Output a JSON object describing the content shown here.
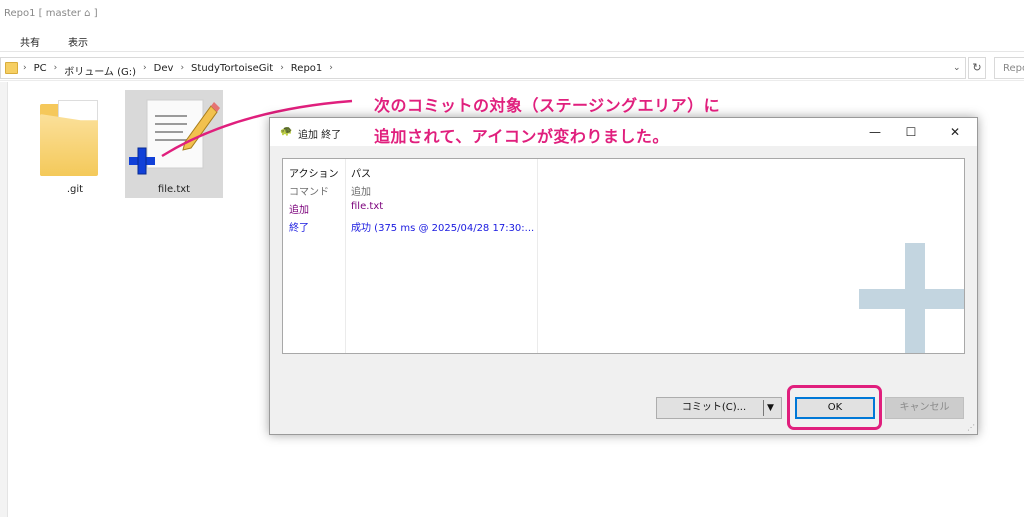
{
  "window": {
    "title": "Repo1 [ master ⌂ ]"
  },
  "ribbon": {
    "tabs": [
      "共有",
      "表示"
    ]
  },
  "address": {
    "crumbs": [
      "PC",
      "ボリューム (G:)",
      "Dev",
      "StudyTortoiseGit",
      "Repo1"
    ],
    "search_placeholder": "Repo"
  },
  "files": [
    {
      "name": ".git"
    },
    {
      "name": "file.txt"
    }
  ],
  "annotation": {
    "line1": "次のコミットの対象（ステージングエリア）に",
    "line2": "追加されて、アイコンが変わりました。",
    "color": "#e01f7d"
  },
  "dialog": {
    "title": "追加 終了",
    "columns": [
      "アクション",
      "パス"
    ],
    "rows": [
      {
        "action": "コマンド",
        "path": "追加",
        "color": "#6d6d6d"
      },
      {
        "action": "追加",
        "path": "file.txt",
        "color": "#7b007b"
      },
      {
        "action": "終了",
        "path": "成功 (375 ms @ 2025/04/28 17:30:...",
        "color": "#1a1ae0"
      }
    ],
    "buttons": {
      "commit": "コミット(C)...",
      "ok": "OK",
      "cancel": "キャンセル"
    }
  }
}
